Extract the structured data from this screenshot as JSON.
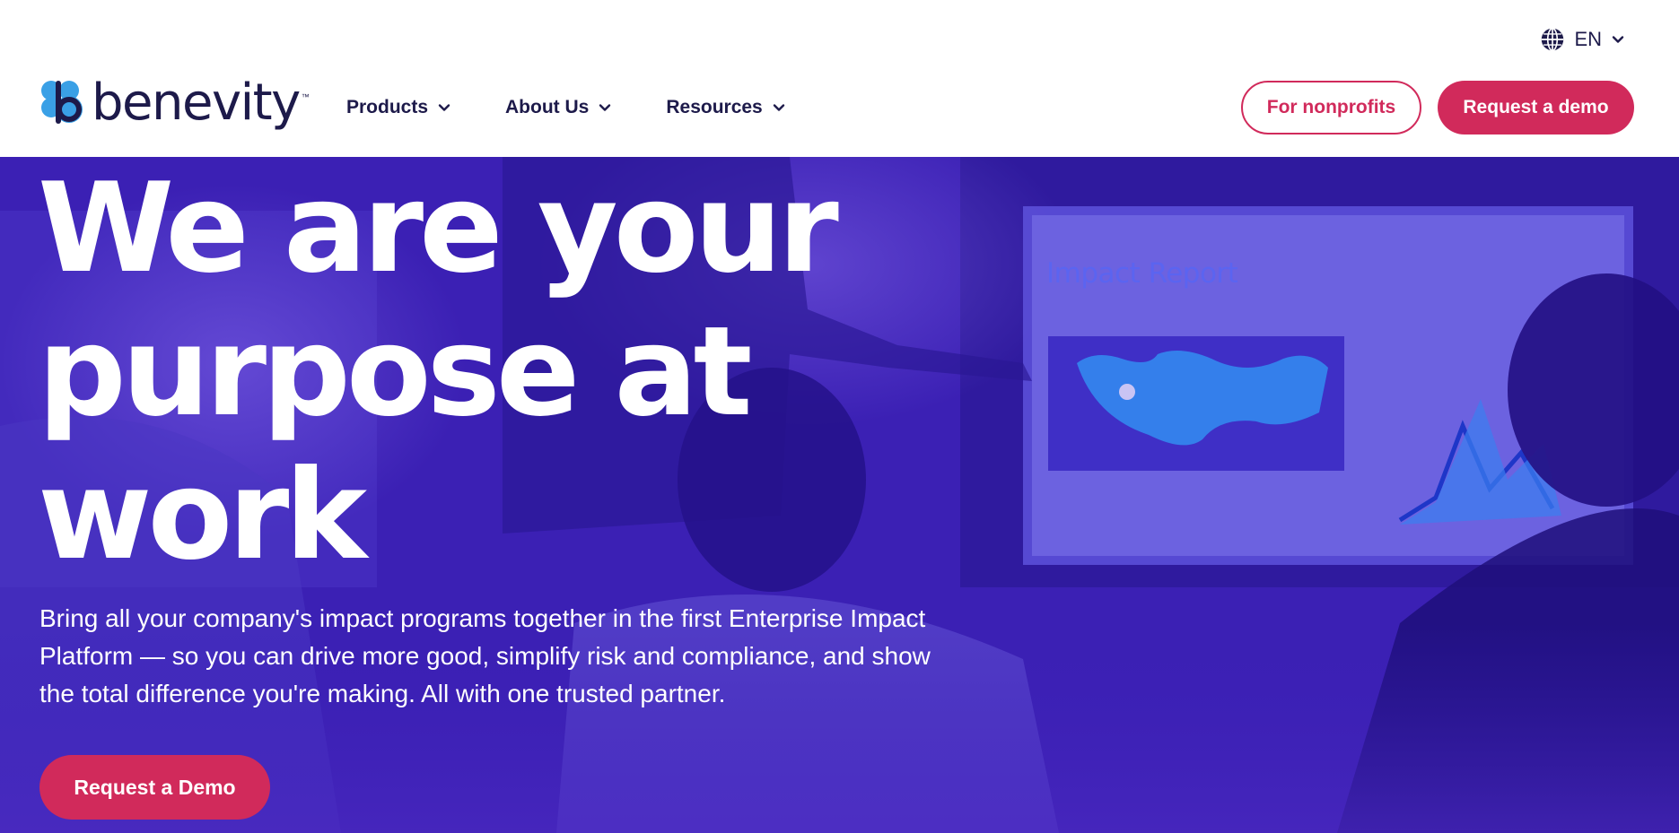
{
  "header": {
    "brand": "benevity",
    "brand_tm": "™",
    "language": "EN",
    "nav": [
      {
        "label": "Products"
      },
      {
        "label": "About Us"
      },
      {
        "label": "Resources"
      }
    ],
    "nonprofits_label": "For nonprofits",
    "demo_label": "Request a demo"
  },
  "hero": {
    "headline_lines": [
      "We are your",
      "purpose at",
      "work"
    ],
    "lead": "Bring all your company's impact programs together in the first Enterprise Impact Platform — so you can drive more good, simplify risk and compliance, and show the total difference you're making. All with one trusted partner.",
    "cta_label": "Request a Demo",
    "screen_title": "Impact Report"
  },
  "colors": {
    "brand_navy": "#1d1a4a",
    "accent_pink": "#d12a5b",
    "hero_purple": "#3a1bb0",
    "logo_blue": "#3aa0e6"
  },
  "icons": {
    "language": "globe-icon",
    "dropdown": "chevron-down-icon"
  }
}
